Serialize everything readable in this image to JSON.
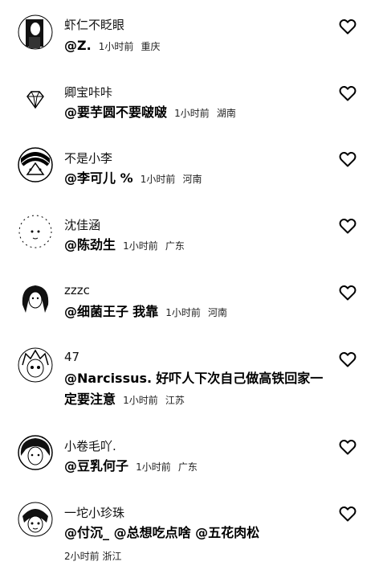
{
  "comments": [
    {
      "name": "虾仁不眨眼",
      "mention": "@Z.",
      "text": "",
      "time": "1小时前",
      "location": "重庆",
      "avatar_icon": "portrait-dark-avatar"
    },
    {
      "name": "卿宝咔咔",
      "mention": "@要芋圆不要啵啵",
      "text": "",
      "time": "1小时前",
      "location": "湖南",
      "avatar_icon": "diamond-icon"
    },
    {
      "name": "不是小李",
      "mention": "@李可儿 %",
      "text": "",
      "time": "1小时前",
      "location": "河南",
      "avatar_icon": "cartoon-avatar"
    },
    {
      "name": "沈佳涵",
      "mention": "@陈劲生",
      "text": "",
      "time": "1小时前",
      "location": "广东",
      "avatar_icon": "sketch-face-avatar"
    },
    {
      "name": "zzzc",
      "mention": "@细菌王子",
      "text": "我靠",
      "time": "1小时前",
      "location": "河南",
      "avatar_icon": "portrait-avatar"
    },
    {
      "name": "47",
      "mention": "@Narcissus.",
      "text": "好吓人下次自己做高铁回家一定要注意",
      "time": "1小时前",
      "location": "江苏",
      "avatar_icon": "anime-avatar"
    },
    {
      "name": "小卷毛吖.",
      "mention": "@豆乳何子",
      "text": "",
      "time": "1小时前",
      "location": "广东",
      "avatar_icon": "portrait-avatar"
    },
    {
      "name": "一坨小珍珠",
      "mention": "@付沉_ @总想吃点啥 @五花肉松",
      "text": "",
      "time": "2小时前",
      "location": "浙江",
      "avatar_icon": "cartoon-avatar"
    }
  ]
}
